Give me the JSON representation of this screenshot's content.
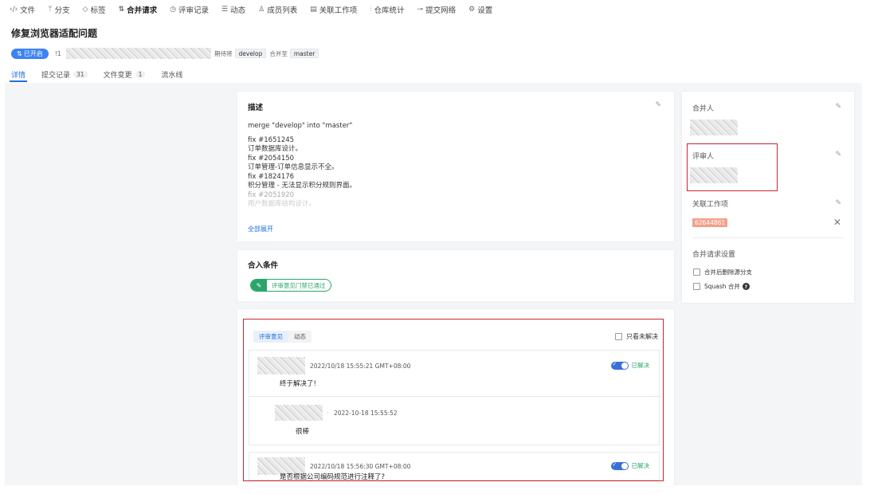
{
  "topnav": [
    {
      "icon": "‹/›",
      "label": "文件",
      "active": false
    },
    {
      "icon": "ᛘ",
      "label": "分支",
      "active": false
    },
    {
      "icon": "◇",
      "label": "标签",
      "active": false
    },
    {
      "icon": "⇅",
      "label": "合并请求",
      "active": true
    },
    {
      "icon": "◷",
      "label": "评审记录",
      "active": false
    },
    {
      "icon": "☰",
      "label": "动态",
      "active": false
    },
    {
      "icon": "♙",
      "label": "成员列表",
      "active": false
    },
    {
      "icon": "▤",
      "label": "关联工作项",
      "active": false
    },
    {
      "icon": "⫶",
      "label": "仓库统计",
      "active": false
    },
    {
      "icon": "⊸",
      "label": "提交网络",
      "active": false
    },
    {
      "icon": "⚙",
      "label": "设置",
      "active": false
    }
  ],
  "title": "修复浏览器适配问题",
  "meta": {
    "status": "已开启",
    "id": "!1",
    "expect_label": "期待将",
    "source_branch": "develop",
    "merge_to_label": "合并至",
    "target_branch": "master"
  },
  "subtabs": [
    {
      "label": "详情",
      "count": null,
      "active": true
    },
    {
      "label": "提交记录",
      "count": "31",
      "active": false
    },
    {
      "label": "文件变更",
      "count": "1",
      "active": false
    },
    {
      "label": "流水线",
      "count": null,
      "active": false
    }
  ],
  "description": {
    "title": "描述",
    "summary": "merge \"develop\" into \"master\"",
    "lines": [
      "fix #1651245",
      "订单数据库设计。",
      "fix #2054150",
      "订单管理-订单信息显示不全。",
      "fix #1824176",
      "积分管理 - 无法显示积分规则界面。",
      "fix #2051920",
      "用户数据库结构设计。"
    ],
    "expand": "全部展开"
  },
  "conditions": {
    "title": "合入条件",
    "tag": "评审意见门禁已通过"
  },
  "review": {
    "tabs": [
      "评审意见",
      "动态"
    ],
    "only_unresolved": "只看未解决",
    "comments": [
      {
        "timestamp": "2022/10/18 15:55:21 GMT+08:00",
        "text": "终于解决了!",
        "status": "已解决"
      },
      {
        "timestamp": "2022/10/18 15:56:30 GMT+08:00",
        "text": "是否根据公司编码规范进行注释了?",
        "status": "已解决"
      }
    ],
    "reply": {
      "sep": "·",
      "timestamp": "2022-10-18 15:55:52",
      "text": "很棒"
    }
  },
  "sidebar": {
    "merger_label": "合并人",
    "reviewer_label": "评审人",
    "workitem_label": "关联工作项",
    "workitem_id": "62644861",
    "settings_label": "合并请求设置",
    "delete_source": "合并后删除源分支",
    "squash": "Squash 合并",
    "help": "?"
  }
}
